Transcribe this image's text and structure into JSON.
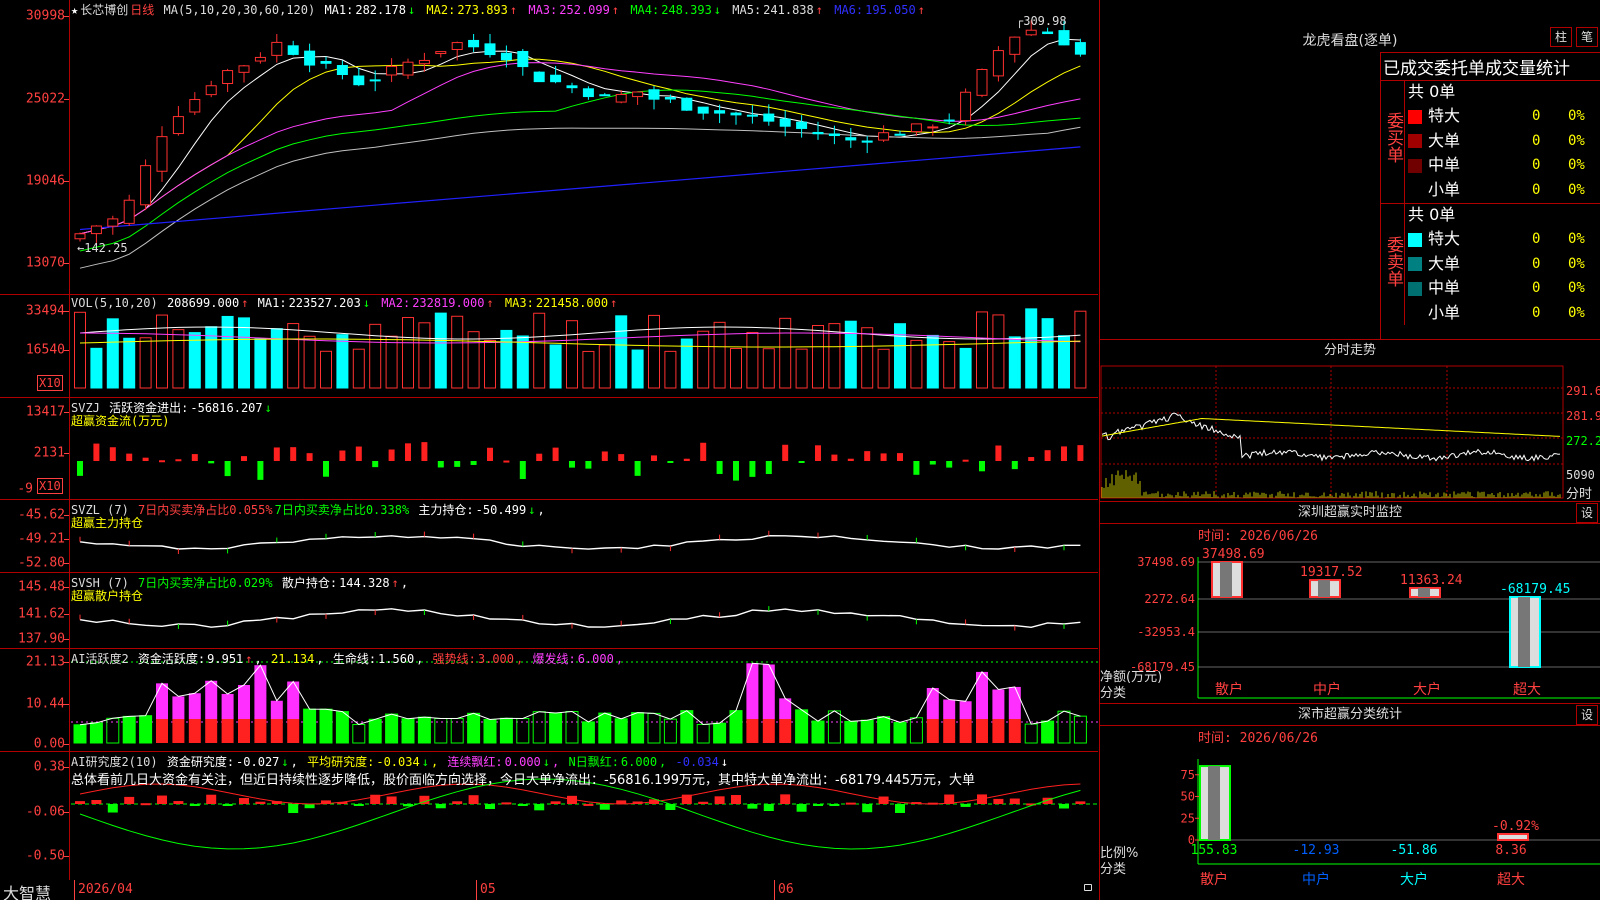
{
  "stock": {
    "name": "长芯博创",
    "period": "日线"
  },
  "candle_head": {
    "ma_def": "MA(5,10,20,30,60,120)",
    "items": [
      {
        "label": "MA1:",
        "value": "282.178",
        "arrow": "↓",
        "color": "#ffffff"
      },
      {
        "label": "MA2:",
        "value": "273.893",
        "arrow": "↑",
        "color": "#ffff00"
      },
      {
        "label": "MA3:",
        "value": "252.099",
        "arrow": "↑",
        "color": "#ff40ff"
      },
      {
        "label": "MA4:",
        "value": "248.393",
        "arrow": "↓",
        "color": "#00ff00"
      },
      {
        "label": "MA5:",
        "value": "241.838",
        "arrow": "↑",
        "color": "#c0c0c0"
      },
      {
        "label": "MA6:",
        "value": "195.050",
        "arrow": "↑",
        "color": "#3030ff"
      }
    ]
  },
  "candle_axis": [
    "30998",
    "25022",
    "19046",
    "13070"
  ],
  "candle_marks": {
    "high": "309.98",
    "low": "142.25"
  },
  "vol_head": {
    "def": "VOL(5,10,20)",
    "value": "208699.000",
    "value_arrow": "↑",
    "items": [
      {
        "label": "MA1:",
        "value": "223527.203",
        "arrow": "↓",
        "color": "#ffffff"
      },
      {
        "label": "MA2:",
        "value": "232819.000",
        "arrow": "↑",
        "color": "#ff40ff"
      },
      {
        "label": "MA3:",
        "value": "221458.000",
        "arrow": "↑",
        "color": "#ffff00"
      }
    ]
  },
  "vol_axis": [
    "33494",
    "16540"
  ],
  "x10": "X10",
  "svzj": {
    "name": "SVZJ",
    "label": "活跃资金进出:",
    "value": "-56816.207",
    "arrow": "↓",
    "sub": "超赢资金流(万元)",
    "axis": [
      "13417",
      "2131",
      "-9"
    ]
  },
  "svzl": {
    "name": "SVZL (7)",
    "a": "7日内买卖净占比0.055%",
    "b": "7日内买卖净占比0.338%",
    "label": "主力持仓:",
    "value": "-50.499",
    "arrow": "↓",
    "sub": "超赢主力持仓",
    "axis": [
      "-45.62",
      "-49.21",
      "-52.80"
    ]
  },
  "svsh": {
    "name": "SVSH (7)",
    "a": "7日内买卖净占比0.029%",
    "label": "散户持仓:",
    "value": "144.328",
    "arrow": "↑",
    "sub": "超赢散户持仓",
    "axis": [
      "145.48",
      "141.62",
      "137.90"
    ]
  },
  "ai1": {
    "name": "AI活跃度2",
    "label": "资金活跃度:",
    "value": "9.951",
    "v2": "21.134",
    "life_label": "生命线:",
    "life": "1.560",
    "strong_label": "强势线:",
    "strong": "3.000",
    "burst_label": "爆发线:",
    "burst": "6.000",
    "axis": [
      "21.13",
      "10.44",
      "0.00"
    ]
  },
  "ai2": {
    "name": "AI研究度2(10)",
    "label": "资金研究度:",
    "value": "-0.027",
    "avg_label": "平均研究度:",
    "avg": "-0.034",
    "lx_label": "连续飘红:",
    "lx": "0.000",
    "n_label": "N日飘红:",
    "n": "6.000",
    "n2": "-0.034",
    "comment": "总体看前几日大资金有关注，但近日持续性逐步降低，股价面临方向选择，今日大单净流出：-56816.199万元，其中特大单净流出：-68179.445万元，大单",
    "axis": [
      "0.38",
      "-0.06",
      "-0.50"
    ]
  },
  "x_axis": {
    "brand": "大智慧",
    "date": "2026/04",
    "m5": "05",
    "m6": "06"
  },
  "lhb": {
    "title": "龙虎看盘(逐单)",
    "btn1": "柱",
    "btn2": "笔",
    "subtitle": "已成交委托单成交量统计",
    "buy": {
      "side": "委买单",
      "total": "共 0单",
      "rows": [
        {
          "label": "特大",
          "v": "0",
          "p": "0%",
          "color": "#ff0000"
        },
        {
          "label": "大单",
          "v": "0",
          "p": "0%",
          "color": "#a00000"
        },
        {
          "label": "中单",
          "v": "0",
          "p": "0%",
          "color": "#700000"
        },
        {
          "label": "小单",
          "v": "0",
          "p": "0%",
          "color": ""
        }
      ]
    },
    "sell": {
      "side": "委卖单",
      "total": "共 0单",
      "rows": [
        {
          "label": "特大",
          "v": "0",
          "p": "0%",
          "color": "#00ffff"
        },
        {
          "label": "大单",
          "v": "0",
          "p": "0%",
          "color": "#008080"
        },
        {
          "label": "中单",
          "v": "0",
          "p": "0%",
          "color": "#007070"
        },
        {
          "label": "小单",
          "v": "0",
          "p": "0%",
          "color": ""
        }
      ]
    }
  },
  "fenshi": {
    "title": "分时走势",
    "axis": [
      "291.6",
      "281.9",
      "272.2"
    ],
    "vol": "5090",
    "vol_label": "分时"
  },
  "monitor": {
    "title": "深圳超赢实时监控",
    "btn": "设",
    "time": "时间: 2026/06/26",
    "axis": [
      "37498.69",
      "2272.64",
      "-32953.4",
      "-68179.45"
    ],
    "ylabel1": "净额(万元)",
    "ylabel2": "分类",
    "bars": [
      {
        "cat": "散户",
        "value": 37498.69,
        "label": "37498.69"
      },
      {
        "cat": "中户",
        "value": 19317.52,
        "label": "19317.52"
      },
      {
        "cat": "大户",
        "value": 11363.24,
        "label": "11363.24"
      },
      {
        "cat": "超大",
        "value": -68179.45,
        "label": "-68179.45"
      }
    ]
  },
  "classify": {
    "title": "深市超赢分类统计",
    "btn": "设",
    "time": "时间: 2026/06/26",
    "axis": [
      "75",
      "50",
      "25",
      "0"
    ],
    "ylabel1": "比例%",
    "ylabel2": "分类",
    "bars": [
      {
        "cat": "散户",
        "value": 155.83,
        "label": "155.83",
        "color": "#00ff00"
      },
      {
        "cat": "中户",
        "value": -12.93,
        "label": "-12.93",
        "color": "#0060ff"
      },
      {
        "cat": "大户",
        "value": -51.86,
        "label": "-51.86",
        "color": "#00ffff"
      },
      {
        "cat": "超大",
        "value": 8.36,
        "label": "8.36",
        "color": "#ff4040",
        "top": "-0.92%"
      }
    ]
  }
}
